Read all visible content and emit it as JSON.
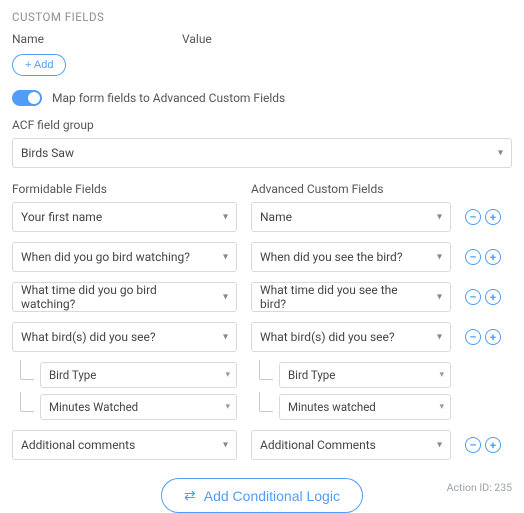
{
  "section_title": "CUSTOM FIELDS",
  "columns": {
    "name": "Name",
    "value": "Value"
  },
  "add_button": "+ Add",
  "toggle": {
    "label": "Map form fields to Advanced Custom Fields",
    "on": true
  },
  "acf_group": {
    "label": "ACF field group",
    "selected": "Birds Saw"
  },
  "mapping_headers": {
    "left": "Formidable Fields",
    "right": "Advanced Custom Fields"
  },
  "rows": [
    {
      "left": "Your first name",
      "right": "Name"
    },
    {
      "left": "When did you go bird watching?",
      "right": "When did you see the bird?"
    },
    {
      "left": "What time did you go bird watching?",
      "right": "What time did you see the bird?"
    },
    {
      "left": "What bird(s) did you see?",
      "right": "What bird(s) did you see?",
      "children": [
        {
          "left": "Bird Type",
          "right": "Bird Type"
        },
        {
          "left": "Minutes Watched",
          "right": "Minutes watched"
        }
      ]
    },
    {
      "left": "Additional comments",
      "right": "Additional Comments"
    }
  ],
  "conditional_button": "Add Conditional Logic",
  "action_id": "Action ID: 235",
  "icons": {
    "chevron": "▾",
    "minus": "–",
    "plus": "+",
    "shuffle": "⇄"
  }
}
